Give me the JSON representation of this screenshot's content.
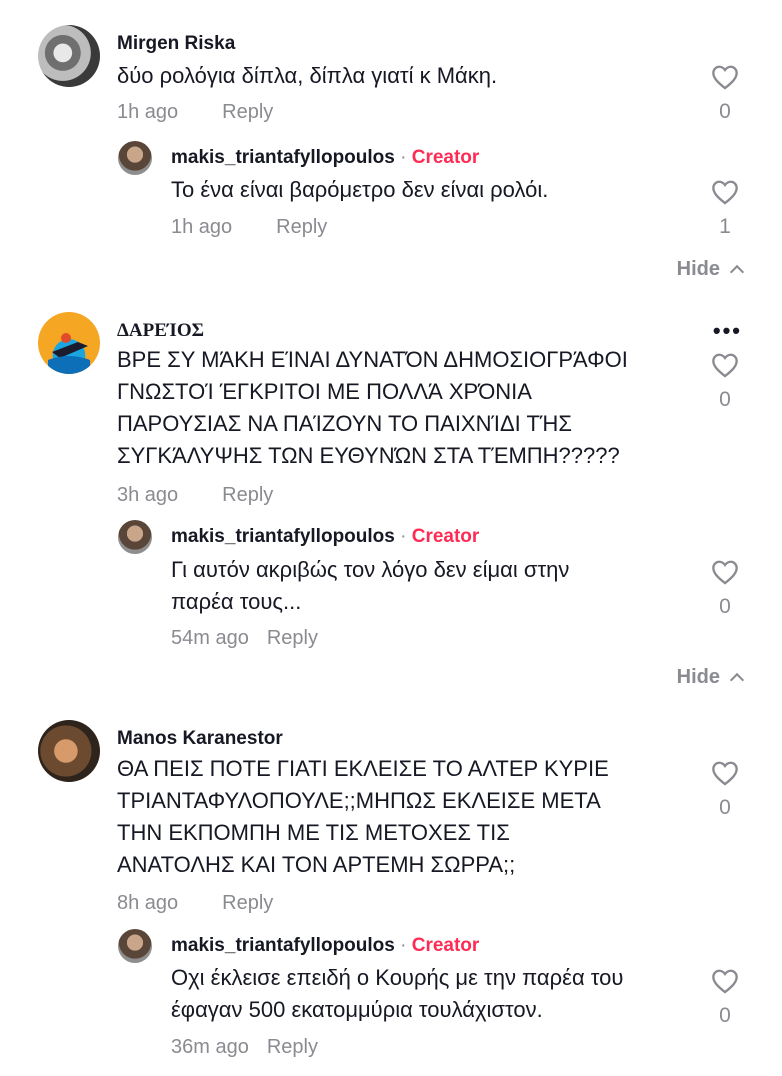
{
  "comments": [
    {
      "username": "Mirgen Riska",
      "lines": [
        "δύο ρολόγια δίπλα, δίπλα γιατί κ Μάκη."
      ],
      "time": "1h ago",
      "reply_label": "Reply",
      "likes": "0",
      "reply": {
        "username": "makis_triantafyllopoulos",
        "sep": " · ",
        "badge": "Creator",
        "lines": [
          "Το ένα είναι βαρόμετρο δεν είναι ρολόι."
        ],
        "time": "1h ago",
        "reply_label": "Reply",
        "likes": "1"
      },
      "hide_label": "Hide"
    },
    {
      "username": "ΔΑΡΕΊΟΣ",
      "lines": [
        "ΒΡΕ ΣΥ ΜΆΚΗ ΕΊΝΑΙ ΔΥΝΑΤΌΝ ΔΗΜΟΣΙΟΓΡΆΦΟΙ",
        "ΓΝΩΣΤΟΊ ΈΓΚΡΙΤΟΙ ΜΕ ΠΟΛΛΆ ΧΡΌΝΙΑ",
        "ΠΑΡΟΥΣΙΑΣ ΝΑ ΠΑΊΖΟΥΝ ΤΟ ΠΑΙΧΝΊΔΙ ΤΉΣ",
        "ΣΥΓΚΆΛΥΨΗΣ ΤΩΝ ΕΥΘΥΝΏΝ ΣΤΑ ΤΈΜΠΗ?????"
      ],
      "time": "3h ago",
      "reply_label": "Reply",
      "likes": "0",
      "more": "•••",
      "reply": {
        "username": "makis_triantafyllopoulos",
        "sep": " · ",
        "badge": "Creator",
        "lines": [
          "Γι αυτόν ακριβώς τον λόγο δεν είμαι στην",
          "παρέα τους..."
        ],
        "time": "54m ago",
        "reply_label": "Reply",
        "likes": "0"
      },
      "hide_label": "Hide"
    },
    {
      "username": "Manos Karanestor",
      "lines": [
        "ΘΑ ΠΕΙΣ ΠΟΤΕ ΓΙΑΤΙ ΕΚΛΕΙΣΕ ΤΟ ΑΛΤΕΡ ΚΥΡΙΕ",
        "ΤΡΙΑΝΤΑΦΥΛΟΠΟΥΛΕ;;ΜΗΠΩΣ ΕΚΛΕΙΣΕ ΜΕΤΑ",
        "ΤΗΝ ΕΚΠΟΜΠΗ ΜΕ ΤΙΣ ΜΕΤΟΧΕΣ ΤΙΣ",
        "ΑΝΑΤΟΛΗΣ ΚΑΙ ΤΟΝ ΑΡΤΕΜΗ ΣΩΡΡΑ;;"
      ],
      "time": "8h ago",
      "reply_label": "Reply",
      "likes": "0",
      "reply": {
        "username": "makis_triantafyllopoulos",
        "sep": " · ",
        "badge": "Creator",
        "lines": [
          "Οχι έκλεισε επειδή ο Κουρής με την παρέα του",
          "έφαγαν 500 εκατομμύρια τουλάχιστον."
        ],
        "time": "36m ago",
        "reply_label": "Reply",
        "likes": "0"
      }
    }
  ],
  "colors": {
    "creator": "#fe2c55",
    "muted": "#8a8b91",
    "text": "#161823"
  },
  "icons": {
    "like": "heart-outline-icon",
    "hide": "chevron-up-icon",
    "more": "more-options-icon"
  }
}
